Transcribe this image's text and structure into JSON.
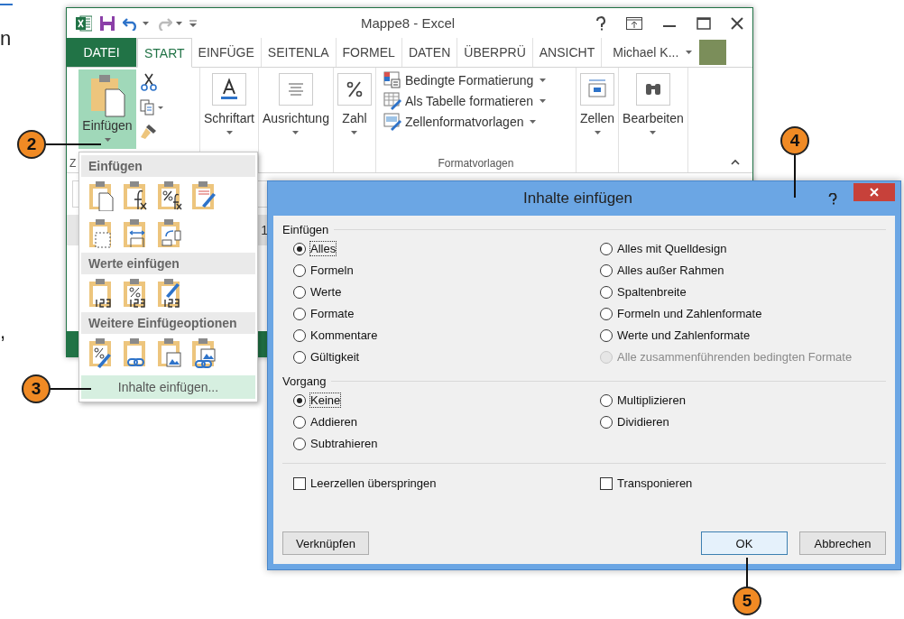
{
  "margin_text": [
    {
      "text": "n"
    },
    {
      "text": ","
    }
  ],
  "excel": {
    "title": "Mappe8 - Excel",
    "user": "Michael K...",
    "tabs": [
      {
        "label": "DATEI",
        "kind": "file",
        "selected": false
      },
      {
        "label": "START",
        "kind": "tab",
        "selected": true
      },
      {
        "label": "EINFÜGE",
        "kind": "tab",
        "selected": false
      },
      {
        "label": "SEITENLA",
        "kind": "tab",
        "selected": false
      },
      {
        "label": "FORMEL",
        "kind": "tab",
        "selected": false
      },
      {
        "label": "DATEN",
        "kind": "tab",
        "selected": false
      },
      {
        "label": "ÜBERPRÜ",
        "kind": "tab",
        "selected": false
      },
      {
        "label": "ANSICHT",
        "kind": "tab",
        "selected": false
      }
    ],
    "paste_button": "Einfügen",
    "clipboard_label": "Z",
    "groups": [
      {
        "label": "Schriftart",
        "kind": "font"
      },
      {
        "label": "Ausrichtung",
        "kind": "align"
      },
      {
        "label": "Zahl",
        "kind": "number"
      }
    ],
    "styles": {
      "items": [
        "Bedingte Formatierung",
        "Als Tabelle formatieren",
        "Zellenformatvorlagen"
      ],
      "label": "Formatvorlagen"
    },
    "groups_right": [
      {
        "label": "Zellen",
        "kind": "cells"
      },
      {
        "label": "Bearbeiten",
        "kind": "find"
      }
    ],
    "cell_fragment": "1"
  },
  "paste_menu": {
    "sections": [
      {
        "title": "Einfügen",
        "rows": [
          [
            {
              "kind": "doc"
            },
            {
              "kind": "fx"
            },
            {
              "kind": "pctfx"
            },
            {
              "kind": "brush"
            }
          ],
          [
            {
              "kind": "dotted"
            },
            {
              "kind": "width"
            },
            {
              "kind": "swap"
            }
          ]
        ]
      },
      {
        "title": "Werte einfügen",
        "rows": [
          [
            {
              "kind": "num"
            },
            {
              "kind": "pctnum"
            },
            {
              "kind": "brushnum"
            }
          ]
        ]
      },
      {
        "title": "Weitere Einfügeoptionen",
        "rows": [
          [
            {
              "kind": "pctbrush"
            },
            {
              "kind": "link"
            },
            {
              "kind": "picture"
            },
            {
              "kind": "picturelink"
            }
          ]
        ]
      }
    ],
    "special": "Inhalte einfügen..."
  },
  "dialog": {
    "title": "Inhalte einfügen",
    "paste_group": {
      "title": "Einfügen",
      "options": [
        {
          "label": "Alles",
          "selected": true,
          "disabled": false
        },
        {
          "label": "Alles mit Quelldesign",
          "selected": false,
          "disabled": false
        },
        {
          "label": "Formeln",
          "selected": false,
          "disabled": false
        },
        {
          "label": "Alles außer Rahmen",
          "selected": false,
          "disabled": false
        },
        {
          "label": "Werte",
          "selected": false,
          "disabled": false
        },
        {
          "label": "Spaltenbreite",
          "selected": false,
          "disabled": false
        },
        {
          "label": "Formate",
          "selected": false,
          "disabled": false
        },
        {
          "label": "Formeln und Zahlenformate",
          "selected": false,
          "disabled": false
        },
        {
          "label": "Kommentare",
          "selected": false,
          "disabled": false
        },
        {
          "label": "Werte und Zahlenformate",
          "selected": false,
          "disabled": false
        },
        {
          "label": "Gültigkeit",
          "selected": false,
          "disabled": false
        },
        {
          "label": "Alle zusammenführenden bedingten Formate",
          "selected": false,
          "disabled": true
        }
      ]
    },
    "operation_group": {
      "title": "Vorgang",
      "options": [
        {
          "label": "Keine",
          "selected": true,
          "disabled": false
        },
        {
          "label": "Multiplizieren",
          "selected": false,
          "disabled": false
        },
        {
          "label": "Addieren",
          "selected": false,
          "disabled": false
        },
        {
          "label": "Dividieren",
          "selected": false,
          "disabled": false
        },
        {
          "label": "Subtrahieren",
          "selected": false,
          "disabled": false
        }
      ]
    },
    "checkboxes": [
      {
        "label": "Leerzellen überspringen",
        "checked": false
      },
      {
        "label": "Transponieren",
        "checked": false
      }
    ],
    "buttons": [
      {
        "label": "Verknüpfen",
        "default": false
      },
      {
        "label": "OK",
        "default": true
      },
      {
        "label": "Abbrechen",
        "default": false
      }
    ]
  },
  "callouts": [
    {
      "number": "2"
    },
    {
      "number": "3"
    },
    {
      "number": "4"
    },
    {
      "number": "5"
    }
  ]
}
